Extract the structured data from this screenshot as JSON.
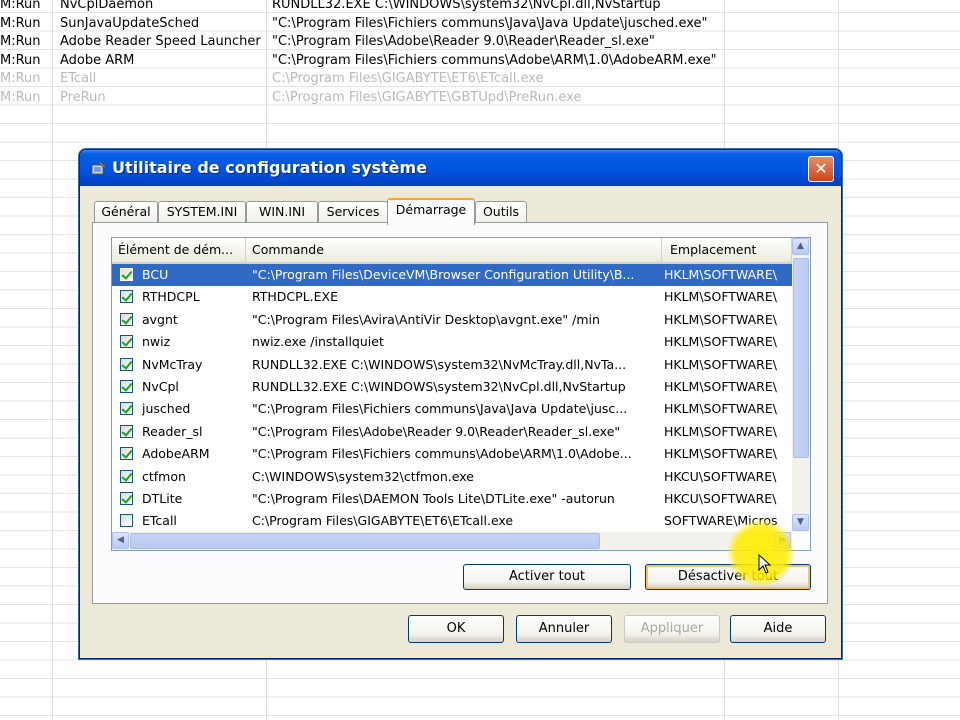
{
  "background_sheet": {
    "rows": [
      {
        "col1": "M:Run",
        "col2": "NvCplDaemon",
        "col3": "RUNDLL32.EXE C:\\WINDOWS\\system32\\NvCpl.dll,NvStartup",
        "dim": false
      },
      {
        "col1": "M:Run",
        "col2": "SunJavaUpdateSched",
        "col3": "\"C:\\Program Files\\Fichiers communs\\Java\\Java Update\\jusched.exe\"",
        "dim": false
      },
      {
        "col1": "M:Run",
        "col2": "Adobe Reader Speed Launcher",
        "col3": "\"C:\\Program Files\\Adobe\\Reader 9.0\\Reader\\Reader_sl.exe\"",
        "dim": false
      },
      {
        "col1": "M:Run",
        "col2": "Adobe ARM",
        "col3": "\"C:\\Program Files\\Fichiers communs\\Adobe\\ARM\\1.0\\AdobeARM.exe\"",
        "dim": false
      },
      {
        "col1": "M:Run",
        "col2": "ETcall",
        "col3": "C:\\Program Files\\GIGABYTE\\ET6\\ETcall.exe",
        "dim": true
      },
      {
        "col1": "M:Run",
        "col2": "PreRun",
        "col3": "C:\\Program Files\\GIGABYTE\\GBTUpd\\PreRun.exe",
        "dim": true
      }
    ]
  },
  "dialog": {
    "title": "Utilitaire de configuration système",
    "close_label": "✕",
    "tabs": [
      {
        "label": "Général",
        "active": false
      },
      {
        "label": "SYSTEM.INI",
        "active": false
      },
      {
        "label": "WIN.INI",
        "active": false
      },
      {
        "label": "Services",
        "active": false
      },
      {
        "label": "Démarrage",
        "active": true
      },
      {
        "label": "Outils",
        "active": false
      }
    ],
    "list": {
      "columns": [
        "Élément de dém...",
        "Commande",
        "Emplacement"
      ],
      "rows": [
        {
          "name": "BCU",
          "command": "\"C:\\Program Files\\DeviceVM\\Browser Configuration Utility\\B...",
          "location": "HKLM\\SOFTWARE\\",
          "checked": true,
          "selected": true
        },
        {
          "name": "RTHDCPL",
          "command": "RTHDCPL.EXE",
          "location": "HKLM\\SOFTWARE\\",
          "checked": true,
          "selected": false
        },
        {
          "name": "avgnt",
          "command": "\"C:\\Program Files\\Avira\\AntiVir Desktop\\avgnt.exe\" /min",
          "location": "HKLM\\SOFTWARE\\",
          "checked": true,
          "selected": false
        },
        {
          "name": "nwiz",
          "command": "nwiz.exe /installquiet",
          "location": "HKLM\\SOFTWARE\\",
          "checked": true,
          "selected": false
        },
        {
          "name": "NvMcTray",
          "command": "RUNDLL32.EXE C:\\WINDOWS\\system32\\NvMcTray.dll,NvTa...",
          "location": "HKLM\\SOFTWARE\\",
          "checked": true,
          "selected": false
        },
        {
          "name": "NvCpl",
          "command": "RUNDLL32.EXE C:\\WINDOWS\\system32\\NvCpl.dll,NvStartup",
          "location": "HKLM\\SOFTWARE\\",
          "checked": true,
          "selected": false
        },
        {
          "name": "jusched",
          "command": "\"C:\\Program Files\\Fichiers communs\\Java\\Java Update\\jusc...",
          "location": "HKLM\\SOFTWARE\\",
          "checked": true,
          "selected": false
        },
        {
          "name": "Reader_sl",
          "command": "\"C:\\Program Files\\Adobe\\Reader 9.0\\Reader\\Reader_sl.exe\"",
          "location": "HKLM\\SOFTWARE\\",
          "checked": true,
          "selected": false
        },
        {
          "name": "AdobeARM",
          "command": "\"C:\\Program Files\\Fichiers communs\\Adobe\\ARM\\1.0\\Adobe...",
          "location": "HKLM\\SOFTWARE\\",
          "checked": true,
          "selected": false
        },
        {
          "name": "ctfmon",
          "command": "C:\\WINDOWS\\system32\\ctfmon.exe",
          "location": "HKCU\\SOFTWARE\\",
          "checked": true,
          "selected": false
        },
        {
          "name": "DTLite",
          "command": "\"C:\\Program Files\\DAEMON Tools Lite\\DTLite.exe\" -autorun",
          "location": "HKCU\\SOFTWARE\\",
          "checked": true,
          "selected": false
        },
        {
          "name": "ETcall",
          "command": "C:\\Program Files\\GIGABYTE\\ET6\\ETcall.exe",
          "location": "SOFTWARE\\Micros",
          "checked": false,
          "selected": false
        }
      ]
    },
    "enable_all_label": "Activer tout",
    "disable_all_label": "Désactiver tout",
    "ok_label": "OK",
    "cancel_label": "Annuler",
    "apply_label": "Appliquer",
    "help_label": "Aide"
  },
  "colors": {
    "titlebar": "#0055e5",
    "selection": "#316ac5",
    "dialog_bg": "#ece9d8",
    "highlight": "#ffec00"
  }
}
